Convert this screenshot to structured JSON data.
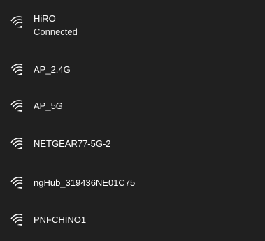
{
  "networks": [
    {
      "ssid": "HiRO",
      "status": "Connected",
      "icon": "wifi-signal-icon"
    },
    {
      "ssid": "AP_2.4G",
      "icon": "wifi-signal-icon"
    },
    {
      "ssid": "AP_5G",
      "icon": "wifi-signal-icon"
    },
    {
      "ssid": "NETGEAR77-5G-2",
      "icon": "wifi-signal-icon"
    },
    {
      "ssid": "ngHub_319436NE01C75",
      "icon": "wifi-signal-icon"
    },
    {
      "ssid": "PNFCHINO1",
      "icon": "wifi-signal-icon"
    }
  ],
  "colors": {
    "background": "#202020",
    "text": "#ffffff"
  }
}
